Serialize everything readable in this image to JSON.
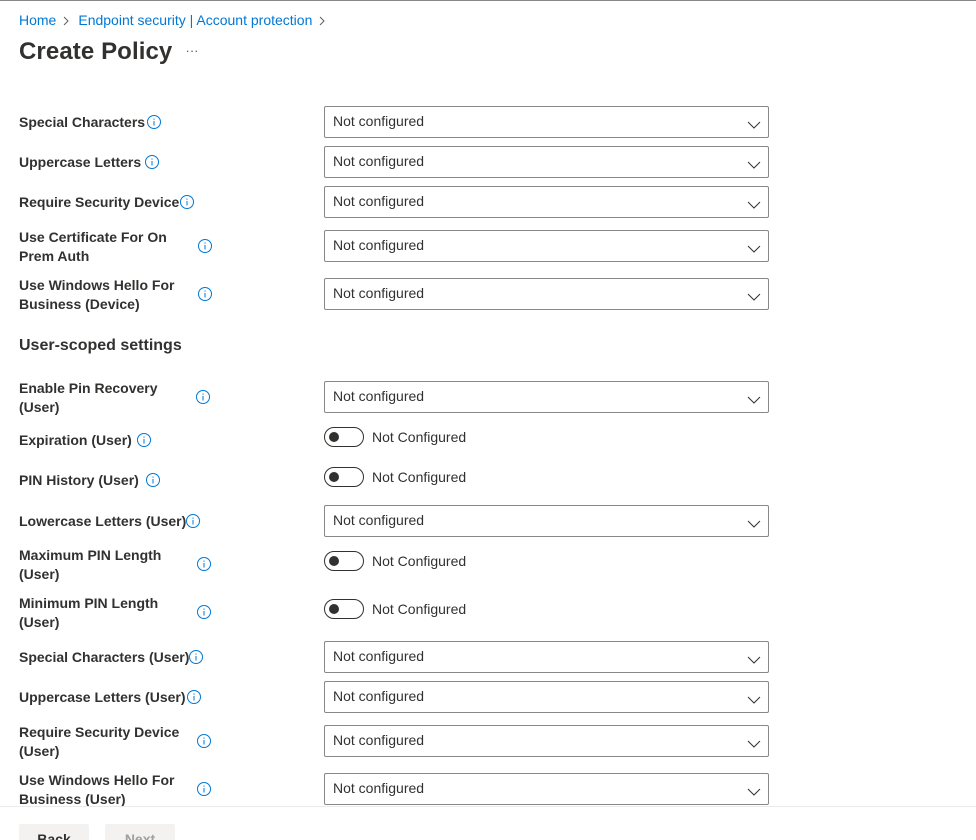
{
  "breadcrumb": [
    {
      "label": "Home"
    },
    {
      "label": "Endpoint security | Account protection"
    }
  ],
  "page": {
    "title": "Create Policy",
    "more_label": "···"
  },
  "section_user": "User-scoped settings",
  "settings_device": [
    {
      "label1": "Special Characters",
      "label2": "",
      "control": "dropdown",
      "value": "Not configured"
    },
    {
      "label1": "Uppercase Letters",
      "label2": "",
      "control": "dropdown",
      "value": "Not configured"
    },
    {
      "label1": "Require Security Device",
      "label2": "",
      "control": "dropdown",
      "value": "Not configured"
    },
    {
      "label1": "Use Certificate For On",
      "label2": "Prem Auth",
      "control": "dropdown",
      "value": "Not configured"
    },
    {
      "label1": "Use Windows Hello For",
      "label2": "Business (Device)",
      "control": "dropdown",
      "value": "Not configured"
    }
  ],
  "settings_user": [
    {
      "label1": "Enable Pin Recovery",
      "label2": "(User)",
      "control": "dropdown",
      "value": "Not configured"
    },
    {
      "label1": "Expiration (User)",
      "label2": "",
      "control": "toggle",
      "value": "Not Configured"
    },
    {
      "label1": "PIN History (User)",
      "label2": "",
      "control": "toggle",
      "value": "Not Configured"
    },
    {
      "label1": "Lowercase Letters (User)",
      "label2": "",
      "control": "dropdown",
      "value": "Not configured"
    },
    {
      "label1": "Maximum PIN Length",
      "label2": "(User)",
      "control": "toggle",
      "value": "Not Configured"
    },
    {
      "label1": "Minimum PIN Length",
      "label2": "(User)",
      "control": "toggle",
      "value": "Not Configured"
    },
    {
      "label1": "Special Characters (User)",
      "label2": "",
      "control": "dropdown",
      "value": "Not configured"
    },
    {
      "label1": "Uppercase Letters (User)",
      "label2": "",
      "control": "dropdown",
      "value": "Not configured"
    },
    {
      "label1": "Require Security Device",
      "label2": "(User)",
      "control": "dropdown",
      "value": "Not configured"
    },
    {
      "label1": "Use Windows Hello For",
      "label2": "Business (User)",
      "control": "dropdown",
      "value": "Not configured"
    }
  ],
  "footer": {
    "back_label": "Back",
    "next_label": "Next"
  },
  "colors": {
    "link": "#0078d4",
    "text": "#323130",
    "border": "#8a8886",
    "disabled_text": "#a19f9d"
  },
  "icons": {
    "breadcrumb_separator": "chevron-right-icon",
    "info": "info-icon",
    "dropdown": "chevron-down-icon"
  }
}
